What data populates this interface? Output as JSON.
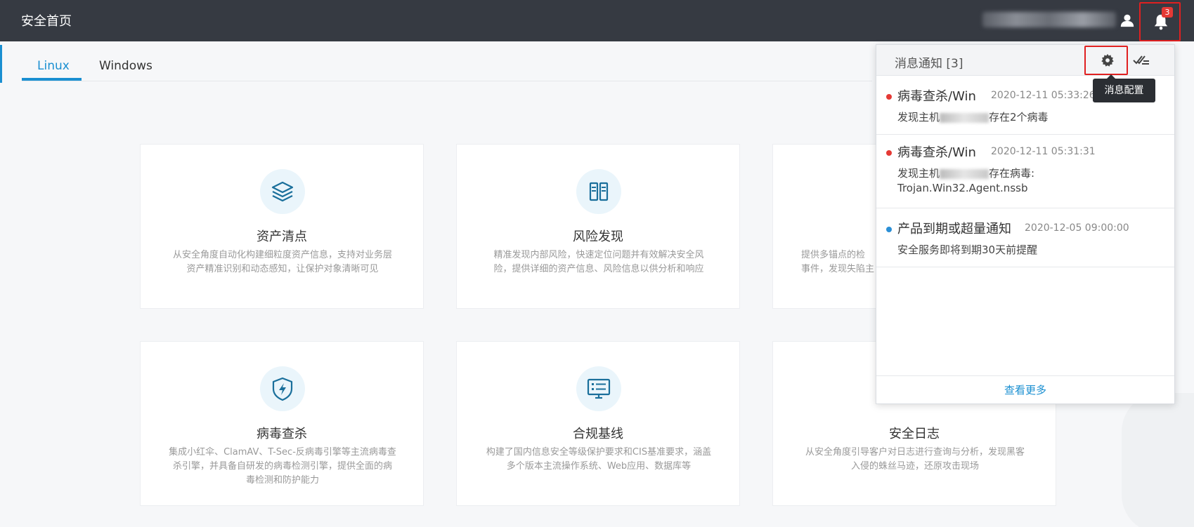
{
  "header": {
    "title": "安全首页",
    "notification_count": "3"
  },
  "tabs": [
    {
      "label": "Linux",
      "active": true
    },
    {
      "label": "Windows",
      "active": false
    }
  ],
  "cards": [
    {
      "title": "资产清点",
      "desc": "从安全角度自动化构建细粒度资产信息，支持对业务层资产精准识别和动态感知，让保护对象清晰可见",
      "icon": "layers-icon"
    },
    {
      "title": "风险发现",
      "desc": "精准发现内部风险，快速定位问题并有效解决安全风险，提供详细的资产信息、风险信息以供分析和响应",
      "icon": "server-icon"
    },
    {
      "title": "",
      "desc": "提供多锚点的检",
      "desc2": "事件，发现失陷主",
      "icon": ""
    },
    {
      "title": "病毒查杀",
      "desc": "集成小红伞、ClamAV、T-Sec-反病毒引擎等主流病毒查杀引擎，并具备自研发的病毒检测引擎，提供全面的病毒检测和防护能力",
      "icon": "shield-bolt-icon"
    },
    {
      "title": "合规基线",
      "desc": "构建了国内信息安全等级保护要求和CIS基准要求，涵盖多个版本主流操作系统、Web应用、数据库等",
      "icon": "monitor-checklist-icon"
    },
    {
      "title": "安全日志",
      "desc": "从安全角度引导客户对日志进行查询与分析，发现黑客入侵的蛛丝马迹，还原攻击现场",
      "icon": ""
    }
  ],
  "notifications": {
    "title": "消息通知 [3]",
    "tooltip": "消息配置",
    "more_label": "查看更多",
    "items": [
      {
        "title": "病毒查杀/Win",
        "time": "2020-12-11 05:33:26",
        "body_prefix": "发现主机",
        "body_suffix": "存在2个病毒",
        "body_line2": "",
        "dot_color": "#e53935"
      },
      {
        "title": "病毒查杀/Win",
        "time": "2020-12-11 05:31:31",
        "body_prefix": "发现主机",
        "body_suffix": "存在病毒:",
        "body_line2": "Trojan.Win32.Agent.nssb",
        "dot_color": "#e53935"
      },
      {
        "title": "产品到期或超量通知",
        "time": "2020-12-05 09:00:00",
        "body_prefix": "安全服务即将到期30天前提醒",
        "body_suffix": "",
        "body_line2": "",
        "dot_color": "#2b8fd6"
      }
    ]
  },
  "colors": {
    "accent": "#1a8fd1",
    "header_bg": "#363a42",
    "highlight_red": "#e02020"
  }
}
